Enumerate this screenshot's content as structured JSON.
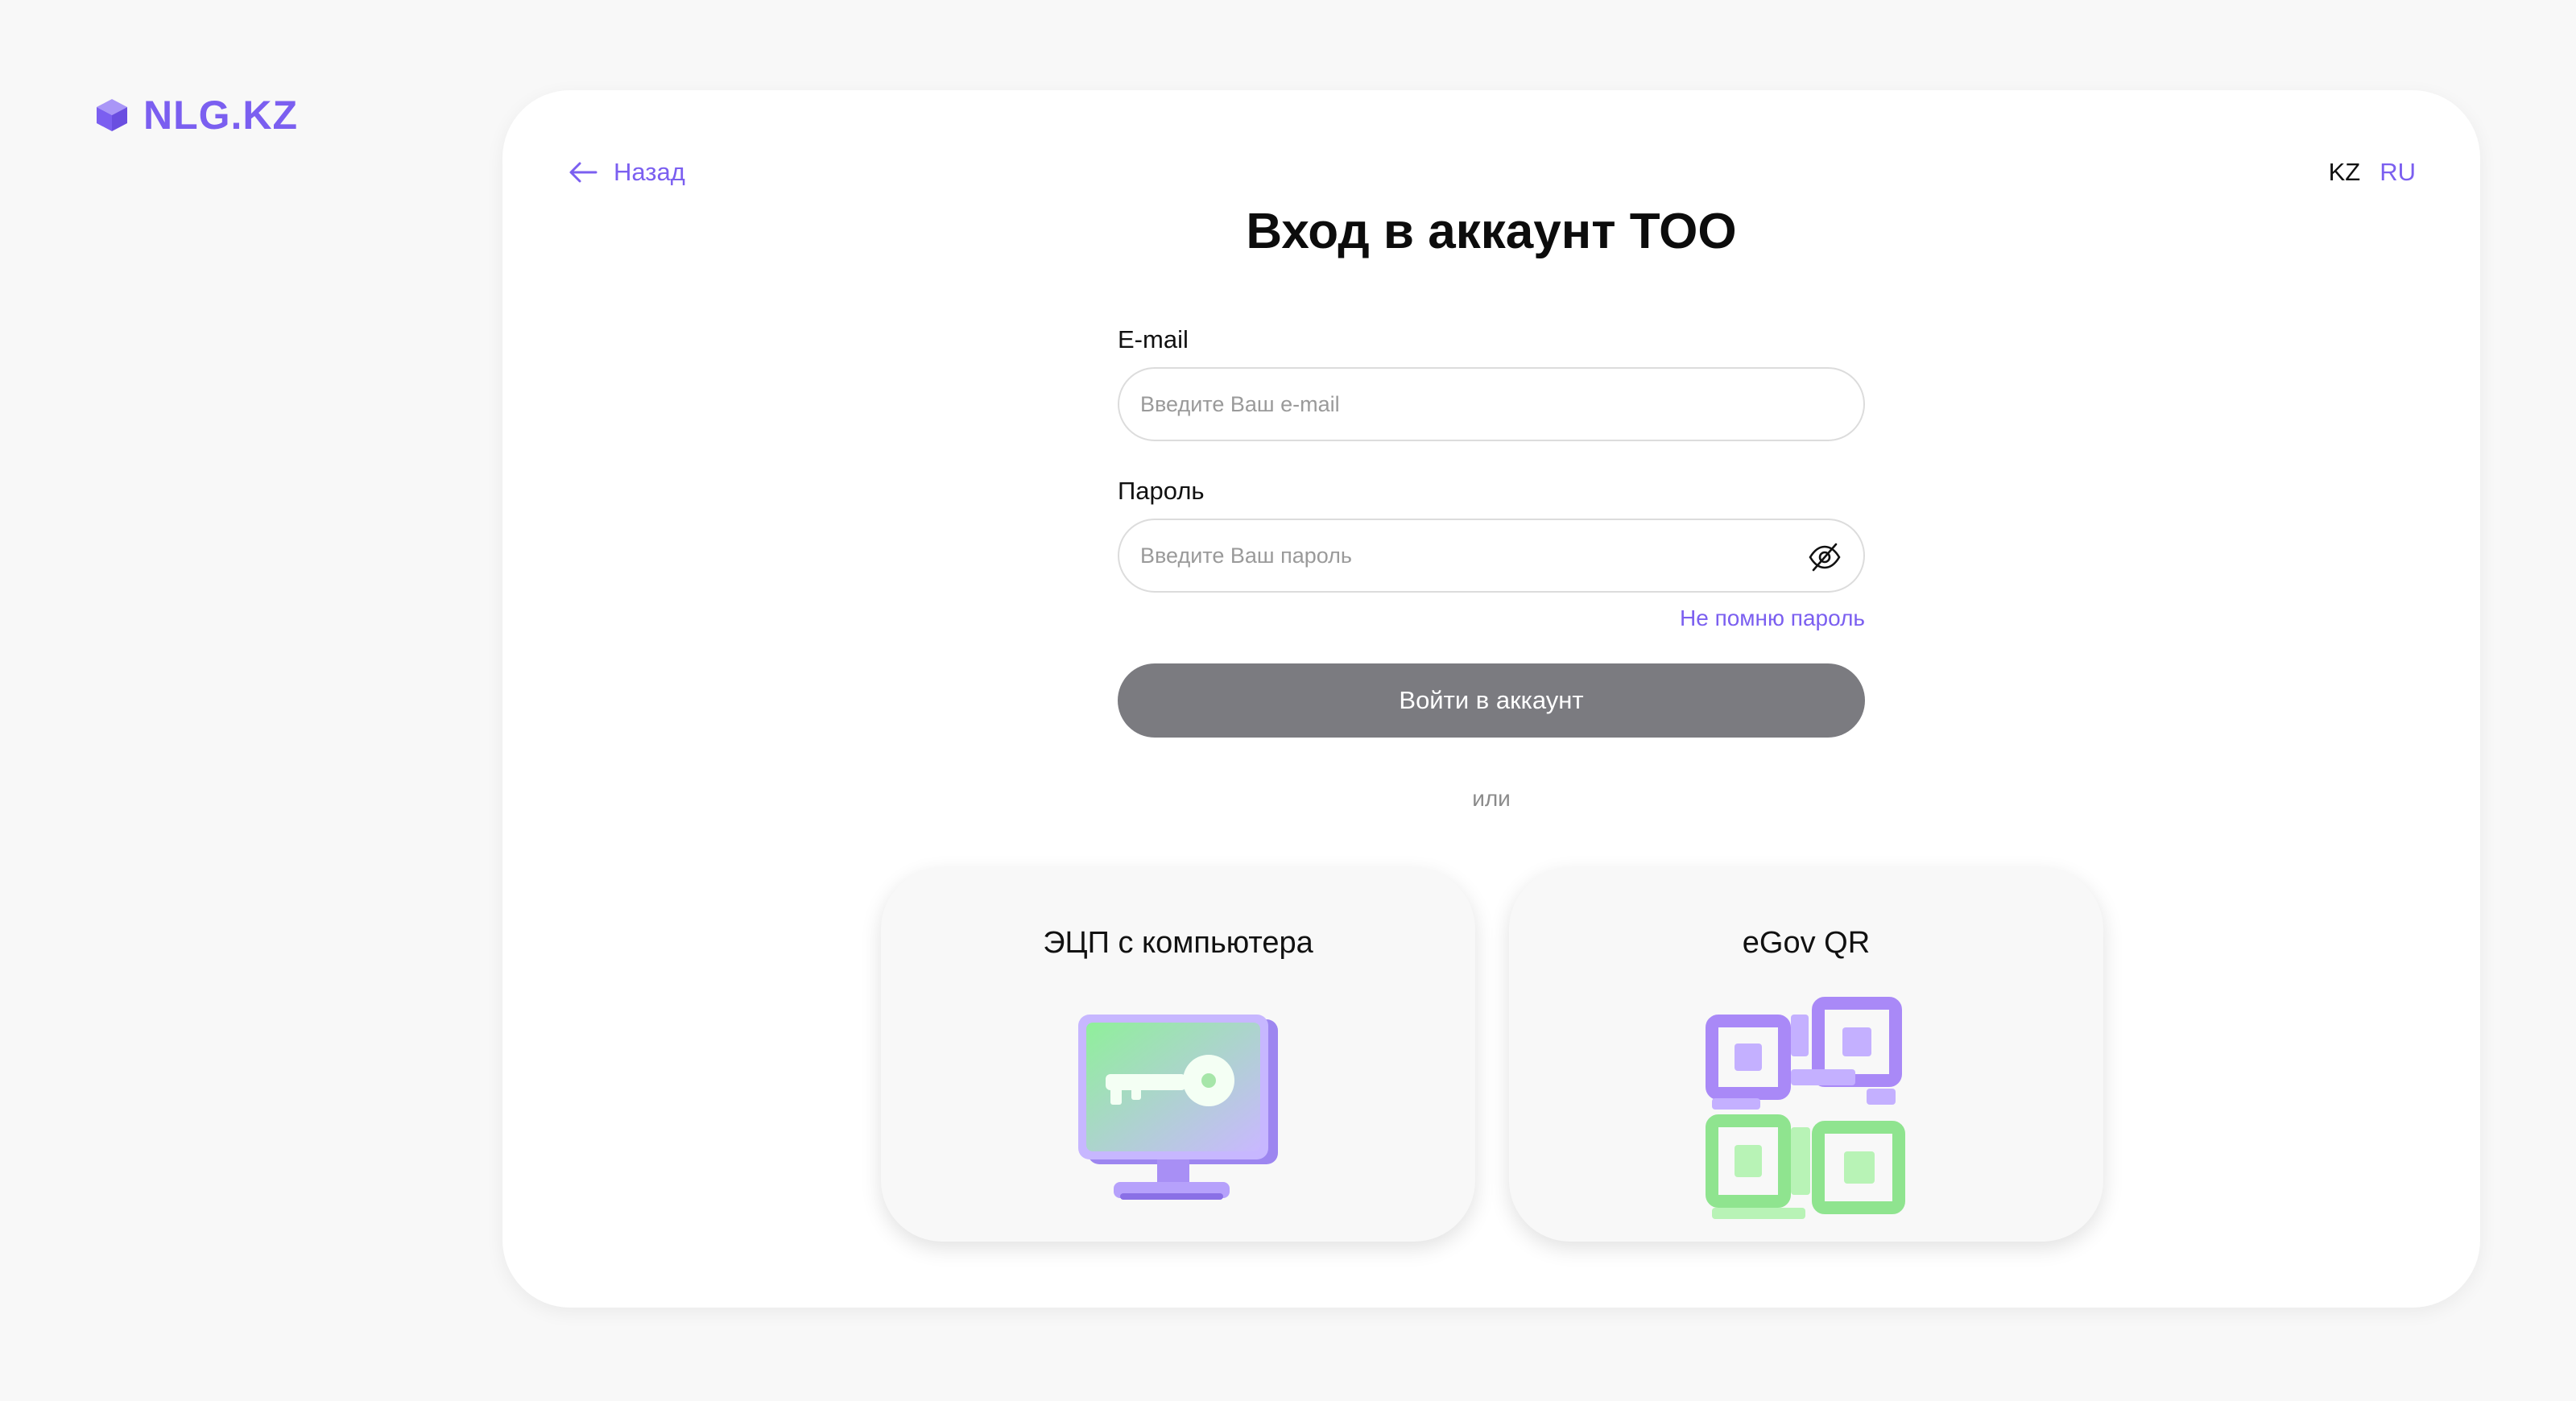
{
  "brand": {
    "name": "NLG.KZ",
    "accent_color": "#7b5ff0",
    "logo_icon": "cube-icon"
  },
  "nav": {
    "back_label": "Назад",
    "back_icon": "arrow-left-icon"
  },
  "language": {
    "options": [
      "KZ",
      "RU"
    ],
    "selected": "RU"
  },
  "login": {
    "title": "Вход в аккаунт ТОО",
    "email": {
      "label": "E-mail",
      "placeholder": "Введите Ваш e-mail",
      "value": ""
    },
    "password": {
      "label": "Пароль",
      "placeholder": "Введите Ваш пароль",
      "value": "",
      "toggle_icon": "eye-off-icon"
    },
    "forgot_label": "Не помню пароль",
    "submit_label": "Войти в аккаунт",
    "submit_color": "#7b7b80",
    "or_label": "или"
  },
  "alt_methods": [
    {
      "label": "ЭЦП с компьютера",
      "icon": "monitor-key-icon"
    },
    {
      "label": "eGov QR",
      "icon": "qr-code-icon"
    }
  ]
}
